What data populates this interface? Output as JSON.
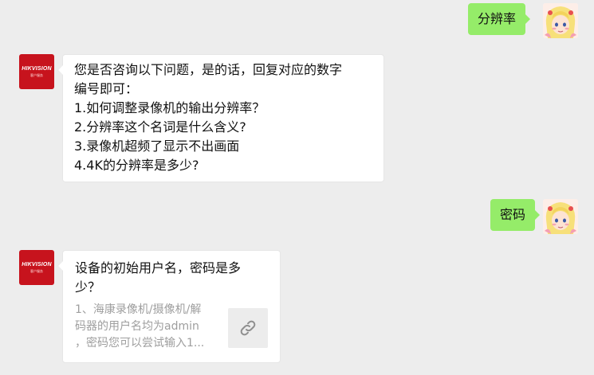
{
  "messages": {
    "user_1": "分辨率",
    "bot_1": {
      "lines": [
        "您是否咨询以下问题，是的话，回复对应的数字",
        "编号即可：",
        "1.如何调整录像机的输出分辨率？",
        "2.分辨率这个名词是什么含义?",
        "3.录像机超频了显示不出画面",
        "4.4K的分辨率是多少?"
      ]
    },
    "user_2": "密码",
    "bot_2": {
      "title_lines": [
        "设备的初始用户名，密码是多",
        "少？"
      ],
      "desc_lines": [
        "1、海康录像机/摄像机/解",
        "码器的用户名均为admin",
        "，密码您可以尝试输入1..."
      ]
    }
  },
  "bot_avatar": {
    "brand": "HIKVISION",
    "sub": "客户服务",
    "color": "#c7131d"
  },
  "colors": {
    "self_bubble": "#95ec69",
    "background": "#ededed"
  },
  "icons": {
    "card_thumb": "link-icon"
  }
}
